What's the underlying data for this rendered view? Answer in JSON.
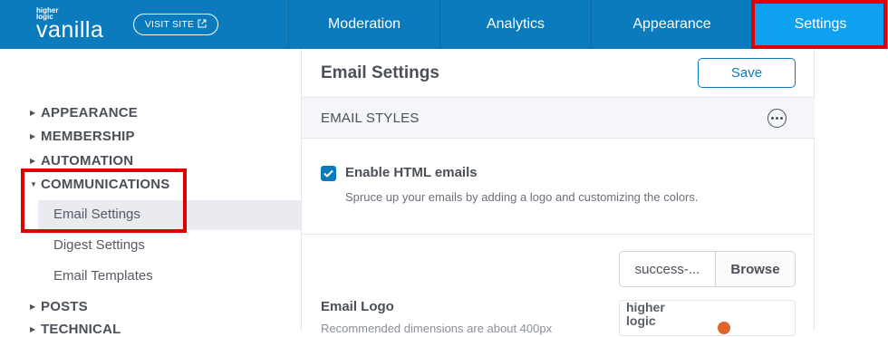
{
  "header": {
    "brand_small": "higher logic",
    "brand_main": "vanilla",
    "visit_site_label": "VISIT SITE",
    "tabs": [
      {
        "label": "Moderation"
      },
      {
        "label": "Analytics"
      },
      {
        "label": "Appearance"
      },
      {
        "label": "Settings",
        "active": true
      }
    ]
  },
  "sidebar": {
    "groups": [
      {
        "label": "APPEARANCE",
        "expanded": false
      },
      {
        "label": "MEMBERSHIP",
        "expanded": false
      },
      {
        "label": "AUTOMATION",
        "expanded": false
      },
      {
        "label": "COMMUNICATIONS",
        "expanded": true
      },
      {
        "label": "POSTS",
        "expanded": false
      },
      {
        "label": "TECHNICAL",
        "expanded": false
      }
    ],
    "communications_items": [
      {
        "label": "Email Settings",
        "active": true
      },
      {
        "label": "Digest Settings"
      },
      {
        "label": "Email Templates"
      }
    ]
  },
  "main": {
    "title": "Email Settings",
    "save_label": "Save",
    "section_title": "EMAIL STYLES",
    "enable_html": {
      "label": "Enable HTML emails",
      "checked": true,
      "description": "Spruce up your emails by adding a logo and customizing the colors."
    },
    "email_logo": {
      "label": "Email Logo",
      "description": "Recommended dimensions are about 400px",
      "file_name": "success-...",
      "browse_label": "Browse",
      "preview_text": "higher logic"
    }
  },
  "colors": {
    "header_bg": "#0b7bbd",
    "active_tab": "#0fa1f0",
    "highlight": "#e10000",
    "accent": "#0b7bbd"
  }
}
